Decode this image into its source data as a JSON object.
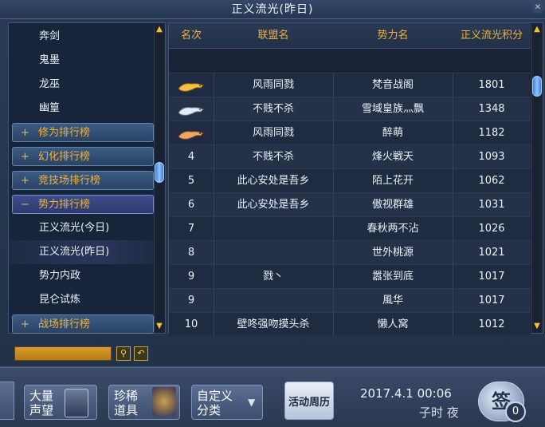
{
  "window": {
    "title": "正义流光(昨日)"
  },
  "sidebar": {
    "rows": [
      {
        "label": "奔剑",
        "kind": "item"
      },
      {
        "label": "鬼墨",
        "kind": "item"
      },
      {
        "label": "龙巫",
        "kind": "item"
      },
      {
        "label": "幽篁",
        "kind": "item"
      },
      {
        "label": "修为排行榜",
        "kind": "category",
        "sign": "+"
      },
      {
        "label": "幻化排行榜",
        "kind": "category",
        "sign": "+"
      },
      {
        "label": "竞技场排行榜",
        "kind": "category",
        "sign": "+"
      },
      {
        "label": "势力排行榜",
        "kind": "category",
        "sign": "−"
      },
      {
        "label": "正义流光(今日)",
        "kind": "item"
      },
      {
        "label": "正义流光(昨日)",
        "kind": "item",
        "selected": true
      },
      {
        "label": "势力内政",
        "kind": "item"
      },
      {
        "label": "昆仑试炼",
        "kind": "item"
      },
      {
        "label": "战场排行榜",
        "kind": "category",
        "sign": "+"
      }
    ]
  },
  "table": {
    "headers": {
      "rank": "名次",
      "alliance": "联盟名",
      "faction": "势力名",
      "score": "正义流光积分"
    },
    "rows": [
      {
        "rank": "",
        "medal": "gold-leopard-medal",
        "alliance": "风雨同戮",
        "faction": "梵音战阁",
        "score": "1801"
      },
      {
        "rank": "",
        "medal": "silver-leopard-medal",
        "alliance": "不贱不杀",
        "faction": "雪域皇族灬飘",
        "score": "1348"
      },
      {
        "rank": "",
        "medal": "bronze-leopard-medal",
        "alliance": "风雨同戮",
        "faction": "醉萌",
        "score": "1182"
      },
      {
        "rank": "4",
        "alliance": "不贱不杀",
        "faction": "烽火戦天",
        "score": "1093"
      },
      {
        "rank": "5",
        "alliance": "此心安处是吾乡",
        "faction": "陌上花开",
        "score": "1062"
      },
      {
        "rank": "6",
        "alliance": "此心安处是吾乡",
        "faction": "傲视群雄",
        "score": "1031"
      },
      {
        "rank": "7",
        "alliance": "",
        "faction": "春秋两不沾",
        "score": "1026"
      },
      {
        "rank": "8",
        "alliance": "",
        "faction": "世外桃源",
        "score": "1021"
      },
      {
        "rank": "9",
        "alliance": "戮丶",
        "faction": "嚣张到底",
        "score": "1017"
      },
      {
        "rank": "9",
        "alliance": "",
        "faction": "風华",
        "score": "1017"
      },
      {
        "rank": "10",
        "alliance": "壁咚强吻摸头杀",
        "faction": "懒人窝",
        "score": "1012"
      }
    ],
    "scroll_position": 0.0
  },
  "search": {
    "value": "",
    "search_icon": "magnifier-icon",
    "reset_icon": "return-arrow-icon"
  },
  "bottombar": {
    "reputation": {
      "line1": "大量",
      "line2": "声望"
    },
    "rare_items": {
      "line1": "珍稀",
      "line2": "道具"
    },
    "custom": {
      "line1": "自定义",
      "line2": "分类"
    },
    "calendar": "活动周历",
    "datetime": "2017.4.1  00:06",
    "shichen": "子时 夜",
    "sign": "签",
    "sign_count": "0"
  },
  "colors": {
    "accent_gold": "#f2b238",
    "panel": "#1a2436",
    "category": "#2a4466"
  }
}
